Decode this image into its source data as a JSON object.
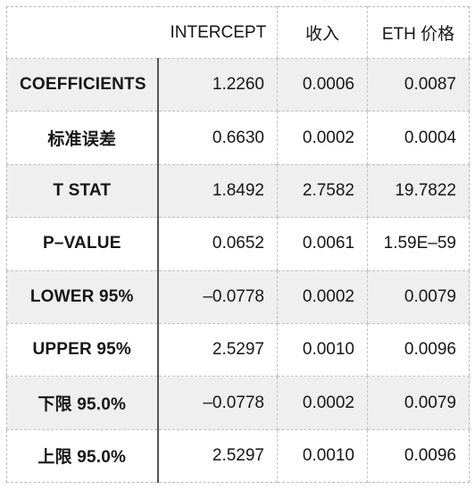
{
  "table": {
    "columns": [
      "",
      "INTERCEPT",
      "收入",
      "ETH 价格"
    ],
    "rows": [
      {
        "label": "COEFFICIENTS",
        "values": [
          "1.2260",
          "0.0006",
          "0.0087"
        ]
      },
      {
        "label": "标准误差",
        "values": [
          "0.6630",
          "0.0002",
          "0.0004"
        ]
      },
      {
        "label": "T STAT",
        "values": [
          "1.8492",
          "2.7582",
          "19.7822"
        ]
      },
      {
        "label": "P–VALUE",
        "values": [
          "0.0652",
          "0.0061",
          "1.59E–59"
        ]
      },
      {
        "label": "LOWER 95%",
        "values": [
          "–0.0778",
          "0.0002",
          "0.0079"
        ]
      },
      {
        "label": "UPPER 95%",
        "values": [
          "2.5297",
          "0.0010",
          "0.0096"
        ]
      },
      {
        "label": "下限  95.0%",
        "values": [
          "–0.0778",
          "0.0002",
          "0.0079"
        ]
      },
      {
        "label": "上限  95.0%",
        "values": [
          "2.5297",
          "0.0010",
          "0.0096"
        ]
      }
    ]
  },
  "colors": {
    "shaded_row": "#efefef",
    "plain_row": "#ffffff",
    "text": "#161616",
    "grid_dashed": "#c2c2c2",
    "grid_solid": "#555555"
  }
}
